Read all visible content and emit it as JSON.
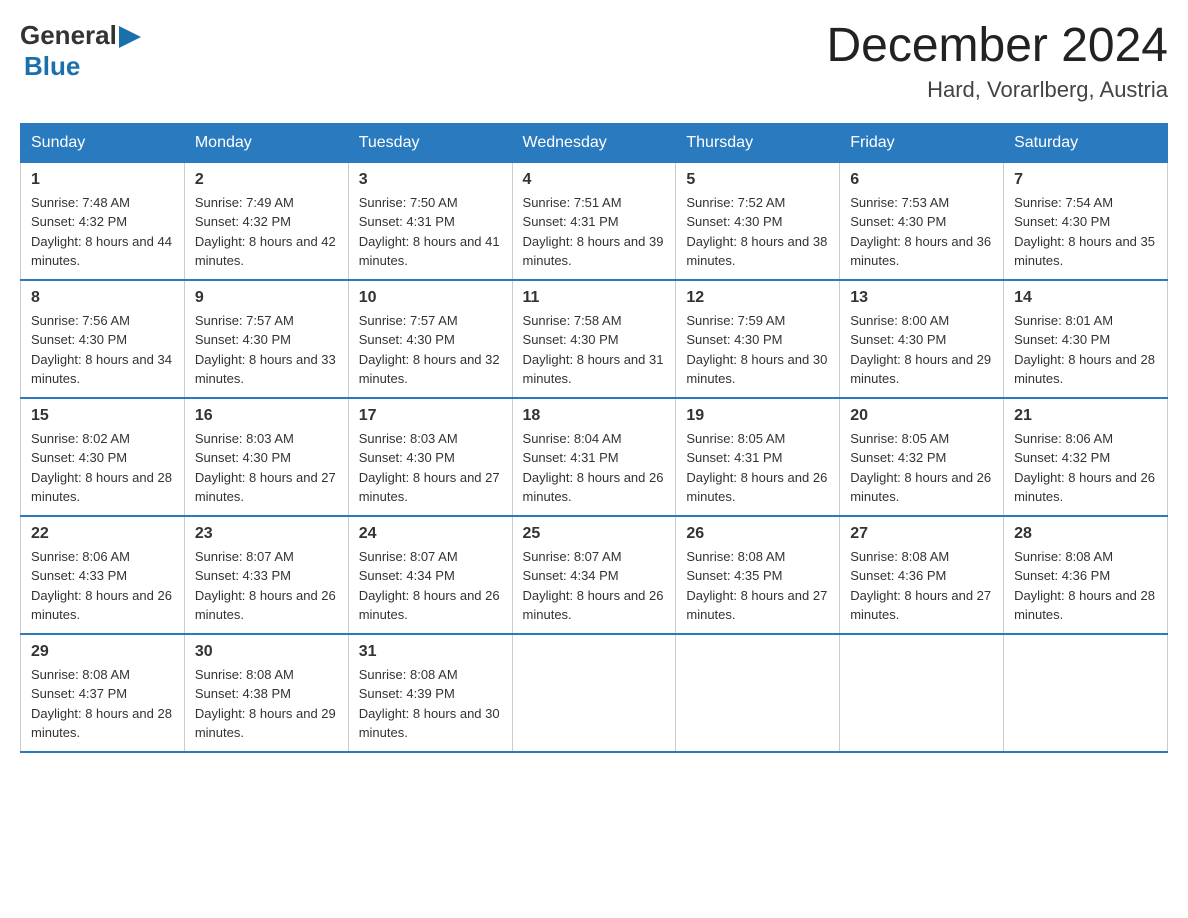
{
  "logo": {
    "general": "General",
    "arrow": "▶",
    "blue": "Blue"
  },
  "header": {
    "month": "December 2024",
    "location": "Hard, Vorarlberg, Austria"
  },
  "weekdays": [
    "Sunday",
    "Monday",
    "Tuesday",
    "Wednesday",
    "Thursday",
    "Friday",
    "Saturday"
  ],
  "weeks": [
    [
      {
        "day": "1",
        "sunrise": "7:48 AM",
        "sunset": "4:32 PM",
        "daylight": "8 hours and 44 minutes."
      },
      {
        "day": "2",
        "sunrise": "7:49 AM",
        "sunset": "4:32 PM",
        "daylight": "8 hours and 42 minutes."
      },
      {
        "day": "3",
        "sunrise": "7:50 AM",
        "sunset": "4:31 PM",
        "daylight": "8 hours and 41 minutes."
      },
      {
        "day": "4",
        "sunrise": "7:51 AM",
        "sunset": "4:31 PM",
        "daylight": "8 hours and 39 minutes."
      },
      {
        "day": "5",
        "sunrise": "7:52 AM",
        "sunset": "4:30 PM",
        "daylight": "8 hours and 38 minutes."
      },
      {
        "day": "6",
        "sunrise": "7:53 AM",
        "sunset": "4:30 PM",
        "daylight": "8 hours and 36 minutes."
      },
      {
        "day": "7",
        "sunrise": "7:54 AM",
        "sunset": "4:30 PM",
        "daylight": "8 hours and 35 minutes."
      }
    ],
    [
      {
        "day": "8",
        "sunrise": "7:56 AM",
        "sunset": "4:30 PM",
        "daylight": "8 hours and 34 minutes."
      },
      {
        "day": "9",
        "sunrise": "7:57 AM",
        "sunset": "4:30 PM",
        "daylight": "8 hours and 33 minutes."
      },
      {
        "day": "10",
        "sunrise": "7:57 AM",
        "sunset": "4:30 PM",
        "daylight": "8 hours and 32 minutes."
      },
      {
        "day": "11",
        "sunrise": "7:58 AM",
        "sunset": "4:30 PM",
        "daylight": "8 hours and 31 minutes."
      },
      {
        "day": "12",
        "sunrise": "7:59 AM",
        "sunset": "4:30 PM",
        "daylight": "8 hours and 30 minutes."
      },
      {
        "day": "13",
        "sunrise": "8:00 AM",
        "sunset": "4:30 PM",
        "daylight": "8 hours and 29 minutes."
      },
      {
        "day": "14",
        "sunrise": "8:01 AM",
        "sunset": "4:30 PM",
        "daylight": "8 hours and 28 minutes."
      }
    ],
    [
      {
        "day": "15",
        "sunrise": "8:02 AM",
        "sunset": "4:30 PM",
        "daylight": "8 hours and 28 minutes."
      },
      {
        "day": "16",
        "sunrise": "8:03 AM",
        "sunset": "4:30 PM",
        "daylight": "8 hours and 27 minutes."
      },
      {
        "day": "17",
        "sunrise": "8:03 AM",
        "sunset": "4:30 PM",
        "daylight": "8 hours and 27 minutes."
      },
      {
        "day": "18",
        "sunrise": "8:04 AM",
        "sunset": "4:31 PM",
        "daylight": "8 hours and 26 minutes."
      },
      {
        "day": "19",
        "sunrise": "8:05 AM",
        "sunset": "4:31 PM",
        "daylight": "8 hours and 26 minutes."
      },
      {
        "day": "20",
        "sunrise": "8:05 AM",
        "sunset": "4:32 PM",
        "daylight": "8 hours and 26 minutes."
      },
      {
        "day": "21",
        "sunrise": "8:06 AM",
        "sunset": "4:32 PM",
        "daylight": "8 hours and 26 minutes."
      }
    ],
    [
      {
        "day": "22",
        "sunrise": "8:06 AM",
        "sunset": "4:33 PM",
        "daylight": "8 hours and 26 minutes."
      },
      {
        "day": "23",
        "sunrise": "8:07 AM",
        "sunset": "4:33 PM",
        "daylight": "8 hours and 26 minutes."
      },
      {
        "day": "24",
        "sunrise": "8:07 AM",
        "sunset": "4:34 PM",
        "daylight": "8 hours and 26 minutes."
      },
      {
        "day": "25",
        "sunrise": "8:07 AM",
        "sunset": "4:34 PM",
        "daylight": "8 hours and 26 minutes."
      },
      {
        "day": "26",
        "sunrise": "8:08 AM",
        "sunset": "4:35 PM",
        "daylight": "8 hours and 27 minutes."
      },
      {
        "day": "27",
        "sunrise": "8:08 AM",
        "sunset": "4:36 PM",
        "daylight": "8 hours and 27 minutes."
      },
      {
        "day": "28",
        "sunrise": "8:08 AM",
        "sunset": "4:36 PM",
        "daylight": "8 hours and 28 minutes."
      }
    ],
    [
      {
        "day": "29",
        "sunrise": "8:08 AM",
        "sunset": "4:37 PM",
        "daylight": "8 hours and 28 minutes."
      },
      {
        "day": "30",
        "sunrise": "8:08 AM",
        "sunset": "4:38 PM",
        "daylight": "8 hours and 29 minutes."
      },
      {
        "day": "31",
        "sunrise": "8:08 AM",
        "sunset": "4:39 PM",
        "daylight": "8 hours and 30 minutes."
      },
      null,
      null,
      null,
      null
    ]
  ]
}
